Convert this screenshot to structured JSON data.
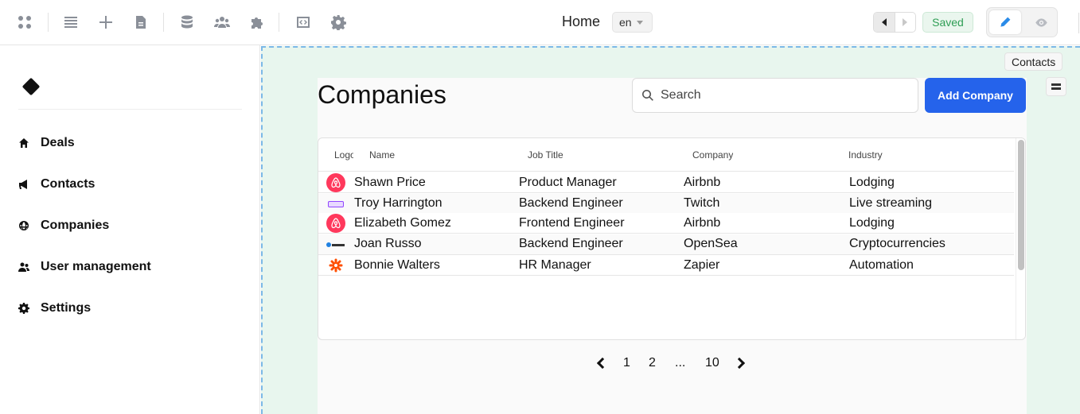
{
  "toolbar": {
    "page_title": "Home",
    "language": "en",
    "saved_label": "Saved",
    "icons": [
      "app-grid-icon",
      "list-icon",
      "plus-icon",
      "file-icon",
      "database-icon",
      "users-icon",
      "puzzle-icon",
      "code-window-icon",
      "gear-icon"
    ]
  },
  "sidebar": {
    "items": [
      {
        "label": "Deals",
        "icon": "home-icon"
      },
      {
        "label": "Contacts",
        "icon": "megaphone-icon"
      },
      {
        "label": "Companies",
        "icon": "globe-icon"
      },
      {
        "label": "User management",
        "icon": "users-icon"
      },
      {
        "label": "Settings",
        "icon": "gear-icon"
      }
    ]
  },
  "canvas": {
    "contacts_tag": "Contacts"
  },
  "main": {
    "title": "Companies",
    "search_placeholder": "Search",
    "add_button": "Add Company",
    "table": {
      "columns": [
        "Logo",
        "Name",
        "Job Title",
        "Company",
        "Industry"
      ],
      "rows": [
        {
          "logo": "airbnb",
          "name": "Shawn Price",
          "job_title": "Product Manager",
          "company": "Airbnb",
          "industry": "Lodging"
        },
        {
          "logo": "twitch",
          "name": "Troy Harrington",
          "job_title": "Backend Engineer",
          "company": "Twitch",
          "industry": "Live streaming"
        },
        {
          "logo": "airbnb",
          "name": "Elizabeth Gomez",
          "job_title": "Frontend Engineer",
          "company": "Airbnb",
          "industry": "Lodging"
        },
        {
          "logo": "opensea",
          "name": "Joan Russo",
          "job_title": "Backend Engineer",
          "company": "OpenSea",
          "industry": "Cryptocurrencies"
        },
        {
          "logo": "zapier",
          "name": "Bonnie Walters",
          "job_title": "HR Manager",
          "company": "Zapier",
          "industry": "Automation"
        }
      ]
    },
    "pagination": {
      "pages": [
        "1",
        "2",
        "...",
        "10"
      ]
    }
  },
  "colors": {
    "accent": "#2563eb",
    "canvas_bg": "#e8f6ee",
    "saved_green": "#2f9e55"
  }
}
